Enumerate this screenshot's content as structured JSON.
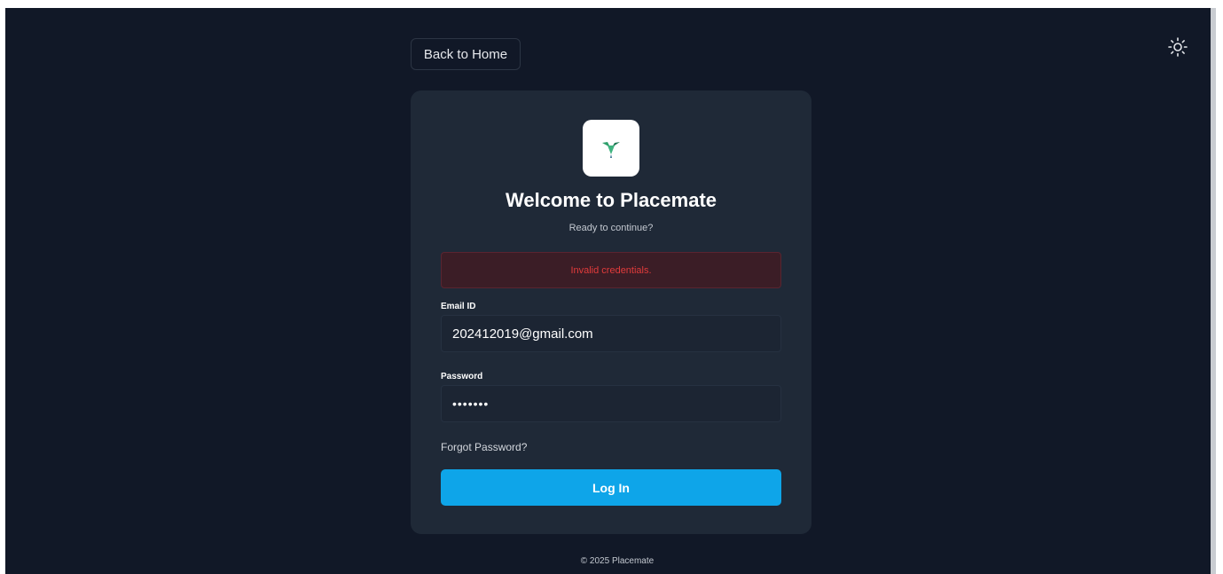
{
  "header": {
    "back_label": "Back to Home",
    "theme_icon": "sun-icon"
  },
  "login": {
    "logo_icon": "hummingbird-logo-icon",
    "title": "Welcome to Placemate",
    "subtitle": "Ready to continue?",
    "error": "Invalid credentials.",
    "email_label": "Email ID",
    "email_value": "202412019@gmail.com",
    "password_label": "Password",
    "password_value": "•••••••",
    "forgot_label": "Forgot Password?",
    "submit_label": "Log In"
  },
  "footer": {
    "copyright": "© 2025 Placemate"
  },
  "colors": {
    "background": "#111827",
    "card": "#1f2937",
    "accent": "#0ea5e9",
    "error_text": "#e23b3b",
    "error_bg": "#3b1d26"
  }
}
